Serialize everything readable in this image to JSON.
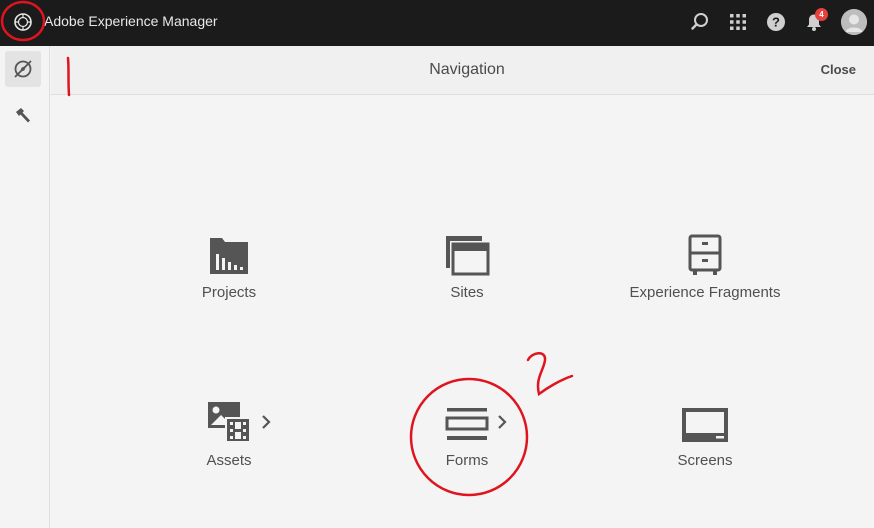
{
  "app": {
    "title": "Adobe Experience Manager"
  },
  "topbar": {
    "brand_icon": "adobe-experience-cloud-icon",
    "notifications_count": "4",
    "icons": [
      "search-icon",
      "solutions-grid-icon",
      "help-icon",
      "bell-icon",
      "user-avatar"
    ]
  },
  "rail": {
    "items": [
      {
        "icon": "navigation-compass-icon",
        "active": true
      },
      {
        "icon": "tools-hammer-icon",
        "active": false
      }
    ]
  },
  "navigation": {
    "title": "Navigation",
    "close_label": "Close",
    "tiles": [
      {
        "label": "Projects",
        "icon": "projects-folder-icon",
        "has_children": false
      },
      {
        "label": "Sites",
        "icon": "sites-pages-icon",
        "has_children": false
      },
      {
        "label": "Experience Fragments",
        "icon": "experience-fragments-icon",
        "has_children": false
      },
      {
        "label": "Assets",
        "icon": "assets-media-icon",
        "has_children": true
      },
      {
        "label": "Forms",
        "icon": "forms-icon",
        "has_children": true
      },
      {
        "label": "Screens",
        "icon": "screens-display-icon",
        "has_children": false
      }
    ]
  },
  "annotations": {
    "step_one": "1",
    "step_two": "2"
  },
  "colors": {
    "topbar": "#1b1b1b",
    "accent_annotation": "#e0141e",
    "icon": "#555555",
    "badge": "#e3423f"
  }
}
